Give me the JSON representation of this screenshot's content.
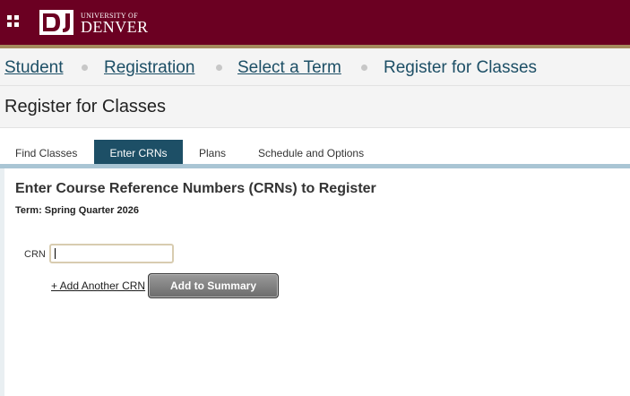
{
  "header": {
    "logo_small": "UNIVERSITY OF",
    "logo_big": "DENVER",
    "logo_mark": "DU",
    "apps_icon": "grid-apps-icon",
    "brand_color": "#6b0022",
    "accent_color": "#a58a5e"
  },
  "breadcrumb": {
    "items": [
      "Student",
      "Registration",
      "Select a Term",
      "Register for Classes"
    ]
  },
  "page": {
    "title": "Register for Classes"
  },
  "tabs": {
    "items": [
      "Find Classes",
      "Enter CRNs",
      "Plans",
      "Schedule and Options"
    ],
    "active": "Enter CRNs",
    "active_color": "#1d4f66"
  },
  "enter_crns": {
    "heading": "Enter Course Reference Numbers (CRNs) to Register",
    "term": "Term: Spring Quarter 2026",
    "crn_label": "CRN",
    "crn_value": "",
    "add_another_label": "+ Add Another CRN",
    "add_to_summary_label": "Add to Summary"
  }
}
